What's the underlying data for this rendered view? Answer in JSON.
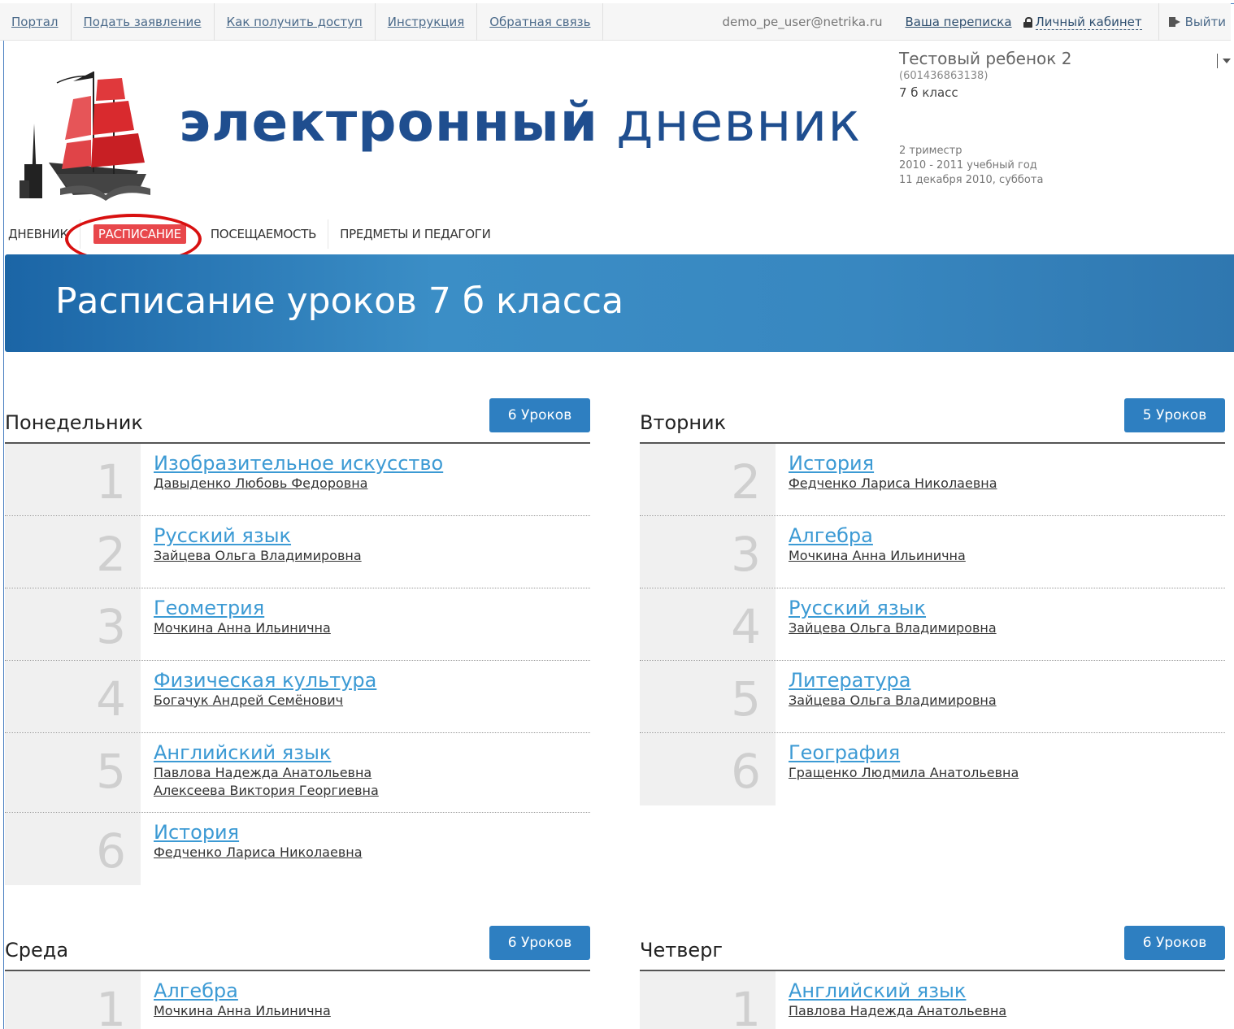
{
  "topnav": {
    "links": [
      "Портал",
      "Подать заявление",
      "Как получить доступ",
      "Инструкция",
      "Обратная связь"
    ],
    "email": "demo_pe_user@netrika.ru",
    "messages": "Ваша переписка",
    "cabinet": "Личный кабинет",
    "logout": "Выйти"
  },
  "brand": {
    "part1": "электронный",
    "part2": "дневник"
  },
  "student": {
    "name": "Тестовый ребенок 2",
    "id": "(601436863138)",
    "class": "7 б класс",
    "term": "2 триместр",
    "year": "2010 - 2011 учебный год",
    "date": "11 декабря 2010, суббота"
  },
  "sections": [
    "Дневник",
    "Расписание",
    "Посещаемость",
    "Предметы и педагоги"
  ],
  "banner": {
    "title": "Расписание уроков 7 б класса"
  },
  "days": [
    {
      "title": "Понедельник",
      "count": "6 Уроков",
      "lessons": [
        {
          "num": "1",
          "subject": "Изобразительное искусство",
          "teachers": [
            "Давыденко Любовь Федоровна"
          ]
        },
        {
          "num": "2",
          "subject": "Русский язык",
          "teachers": [
            "Зайцева Ольга Владимировна"
          ]
        },
        {
          "num": "3",
          "subject": "Геометрия",
          "teachers": [
            "Мочкина Анна Ильинична"
          ]
        },
        {
          "num": "4",
          "subject": "Физическая культура",
          "teachers": [
            "Богачук Андрей Семёнович"
          ]
        },
        {
          "num": "5",
          "subject": "Английский язык",
          "teachers": [
            "Павлова Надежда Анатольевна",
            "Алексеева Виктория Георгиевна"
          ]
        },
        {
          "num": "6",
          "subject": "История",
          "teachers": [
            "Федченко Лариса Николаевна"
          ]
        }
      ]
    },
    {
      "title": "Вторник",
      "count": "5 Уроков",
      "lessons": [
        {
          "num": "2",
          "subject": "История",
          "teachers": [
            "Федченко Лариса Николаевна"
          ]
        },
        {
          "num": "3",
          "subject": "Алгебра",
          "teachers": [
            "Мочкина Анна Ильинична"
          ]
        },
        {
          "num": "4",
          "subject": "Русский язык",
          "teachers": [
            "Зайцева Ольга Владимировна"
          ]
        },
        {
          "num": "5",
          "subject": "Литература",
          "teachers": [
            "Зайцева Ольга Владимировна"
          ]
        },
        {
          "num": "6",
          "subject": "География",
          "teachers": [
            "Гращенко Людмила Анатольевна"
          ]
        }
      ]
    },
    {
      "title": "Среда",
      "count": "6 Уроков",
      "lessons": [
        {
          "num": "1",
          "subject": "Алгебра",
          "teachers": [
            "Мочкина Анна Ильинична"
          ]
        }
      ]
    },
    {
      "title": "Четверг",
      "count": "6 Уроков",
      "lessons": [
        {
          "num": "1",
          "subject": "Английский язык",
          "teachers": [
            "Павлова Надежда Анатольевна"
          ]
        }
      ]
    }
  ]
}
